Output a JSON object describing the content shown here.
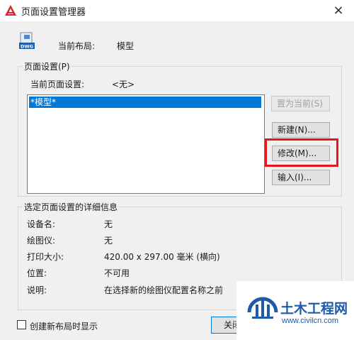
{
  "window": {
    "title": "页面设置管理器",
    "close_glyph": "×"
  },
  "current_layout": {
    "label": "当前布局:",
    "value": "模型"
  },
  "page_setups": {
    "legend": "页面设置(P)",
    "current_label": "当前页面设置:",
    "current_value": "<无>",
    "items": [
      "*模型*"
    ]
  },
  "buttons": {
    "set_current": "置为当前(S)",
    "new": "新建(N)...",
    "modify": "修改(M)...",
    "import": "输入(I)..."
  },
  "details": {
    "legend": "选定页面设置的详细信息",
    "rows": [
      {
        "label": "设备名:",
        "value": "无"
      },
      {
        "label": "绘图仪:",
        "value": "无"
      },
      {
        "label": "打印大小:",
        "value": "420.00 x 297.00 毫米 (横向)"
      },
      {
        "label": "位置:",
        "value": "不可用"
      },
      {
        "label": "说明:",
        "value": "在选择新的绘图仪配置名称之前"
      }
    ]
  },
  "footer": {
    "checkbox_label": "创建新布局时显示",
    "checkbox_checked": false,
    "close_label": "关闭"
  },
  "watermark": {
    "brand": "土木工程网",
    "url": "www.civilcn.com"
  },
  "colors": {
    "selection": "#0078d7",
    "highlight": "#e8141c",
    "watermark": "#1e5aa8",
    "app_icon": "#d9262c"
  }
}
